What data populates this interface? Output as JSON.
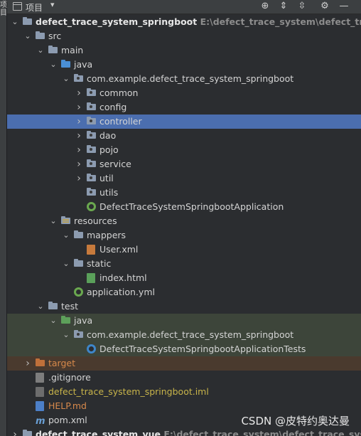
{
  "left_strip": {
    "label": "项目"
  },
  "header": {
    "title": "项目"
  },
  "watermark": "CSDN @皮特约奥达曼",
  "tree": [
    {
      "label": "defect_trace_system_springboot",
      "path": "E:\\defect_trace_system\\defect_trace_system",
      "depth": 0,
      "icon": "module-folder-icon",
      "expanded": true
    },
    {
      "label": "src",
      "depth": 1,
      "icon": "folder-icon",
      "expanded": true
    },
    {
      "label": "main",
      "depth": 2,
      "icon": "folder-icon",
      "expanded": true
    },
    {
      "label": "java",
      "depth": 3,
      "icon": "source-folder-icon",
      "expanded": true
    },
    {
      "label": "com.example.defect_trace_system_springboot",
      "depth": 4,
      "icon": "package-icon",
      "expanded": true
    },
    {
      "label": "common",
      "depth": 5,
      "icon": "package-icon",
      "expanded": false
    },
    {
      "label": "config",
      "depth": 5,
      "icon": "package-icon",
      "expanded": false
    },
    {
      "label": "controller",
      "depth": 5,
      "icon": "package-icon",
      "expanded": false,
      "selected": true
    },
    {
      "label": "dao",
      "depth": 5,
      "icon": "package-icon",
      "expanded": false
    },
    {
      "label": "pojo",
      "depth": 5,
      "icon": "package-icon",
      "expanded": false
    },
    {
      "label": "service",
      "depth": 5,
      "icon": "package-icon",
      "expanded": false
    },
    {
      "label": "util",
      "depth": 5,
      "icon": "package-icon",
      "expanded": false
    },
    {
      "label": "utils",
      "depth": 5,
      "icon": "package-icon"
    },
    {
      "label": "DefectTraceSystemSpringbootApplication",
      "depth": 5,
      "icon": "spring-boot-class-icon"
    },
    {
      "label": "resources",
      "depth": 3,
      "icon": "resources-folder-icon",
      "expanded": true
    },
    {
      "label": "mappers",
      "depth": 4,
      "icon": "folder-icon",
      "expanded": true
    },
    {
      "label": "User.xml",
      "depth": 5,
      "icon": "xml-file-icon"
    },
    {
      "label": "static",
      "depth": 4,
      "icon": "folder-icon",
      "expanded": true
    },
    {
      "label": "index.html",
      "depth": 5,
      "icon": "html-file-icon"
    },
    {
      "label": "application.yml",
      "depth": 4,
      "icon": "spring-config-icon"
    },
    {
      "label": "test",
      "depth": 2,
      "icon": "folder-icon",
      "expanded": true
    },
    {
      "label": "java",
      "depth": 3,
      "icon": "test-source-folder-icon",
      "expanded": true,
      "highlight": "test"
    },
    {
      "label": "com.example.defect_trace_system_springboot",
      "depth": 4,
      "icon": "package-icon",
      "expanded": true,
      "highlight": "test"
    },
    {
      "label": "DefectTraceSystemSpringbootApplicationTests",
      "depth": 5,
      "icon": "test-class-icon",
      "highlight": "test"
    },
    {
      "label": "target",
      "depth": 1,
      "icon": "excluded-folder-icon",
      "expanded": false,
      "highlight": "excluded",
      "color": "orange"
    },
    {
      "label": ".gitignore",
      "depth": 1,
      "icon": "gitignore-file-icon"
    },
    {
      "label": "defect_trace_system_springboot.iml",
      "depth": 1,
      "icon": "iml-file-icon",
      "color": "yellow"
    },
    {
      "label": "HELP.md",
      "depth": 1,
      "icon": "markdown-file-icon",
      "color": "orange"
    },
    {
      "label": "pom.xml",
      "depth": 1,
      "icon": "maven-file-icon"
    },
    {
      "label": "defect_trace_system_vue",
      "path": "E:\\defect_trace_system\\defect_trace_system_vue",
      "depth": 0,
      "icon": "module-folder-icon",
      "expanded": false
    }
  ]
}
